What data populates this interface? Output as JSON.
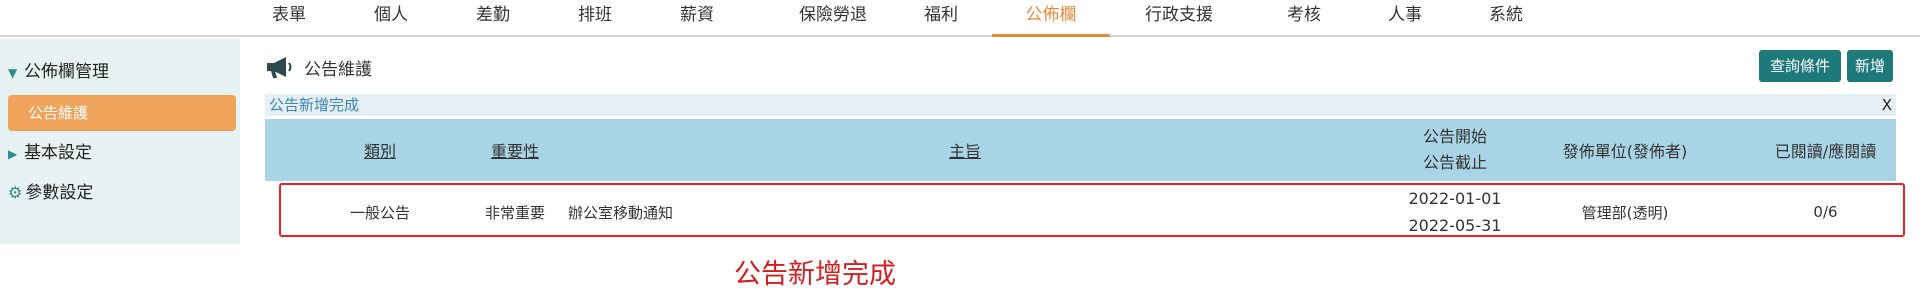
{
  "nav": {
    "items": [
      "表單",
      "個人",
      "差勤",
      "排班",
      "薪資",
      "保險勞退",
      "福利",
      "公佈欄",
      "行政支援",
      "考核",
      "人事",
      "系統"
    ],
    "active": "公佈欄",
    "accent_color": "#e88a3c"
  },
  "sidebar": {
    "bulletin_mgmt": "公佈欄管理",
    "announcement_maintenance": "公告維護",
    "basic_settings": "基本設定",
    "parameter_settings": "參數設定",
    "active_color": "#f0a35b"
  },
  "page": {
    "title": "公告維護",
    "title_icon": "megaphone-icon"
  },
  "toolbar": {
    "query_label": "查詢條件",
    "add_label": "新增"
  },
  "notice": {
    "message": "公告新增完成",
    "close": "X"
  },
  "table": {
    "headers": {
      "category": "類別",
      "importance": "重要性",
      "subject": "主旨",
      "start": "公告開始",
      "end": "公告截止",
      "publisher": "發佈單位(發佈者)",
      "read": "已閱讀/應閱讀"
    },
    "rows": [
      {
        "category": "一般公告",
        "importance": "非常重要",
        "subject": "辦公室移動通知",
        "start": "2022-01-01",
        "end": "2022-05-31",
        "publisher": "管理部(透明)",
        "read": "0/6"
      }
    ]
  },
  "caption": "公告新增完成"
}
